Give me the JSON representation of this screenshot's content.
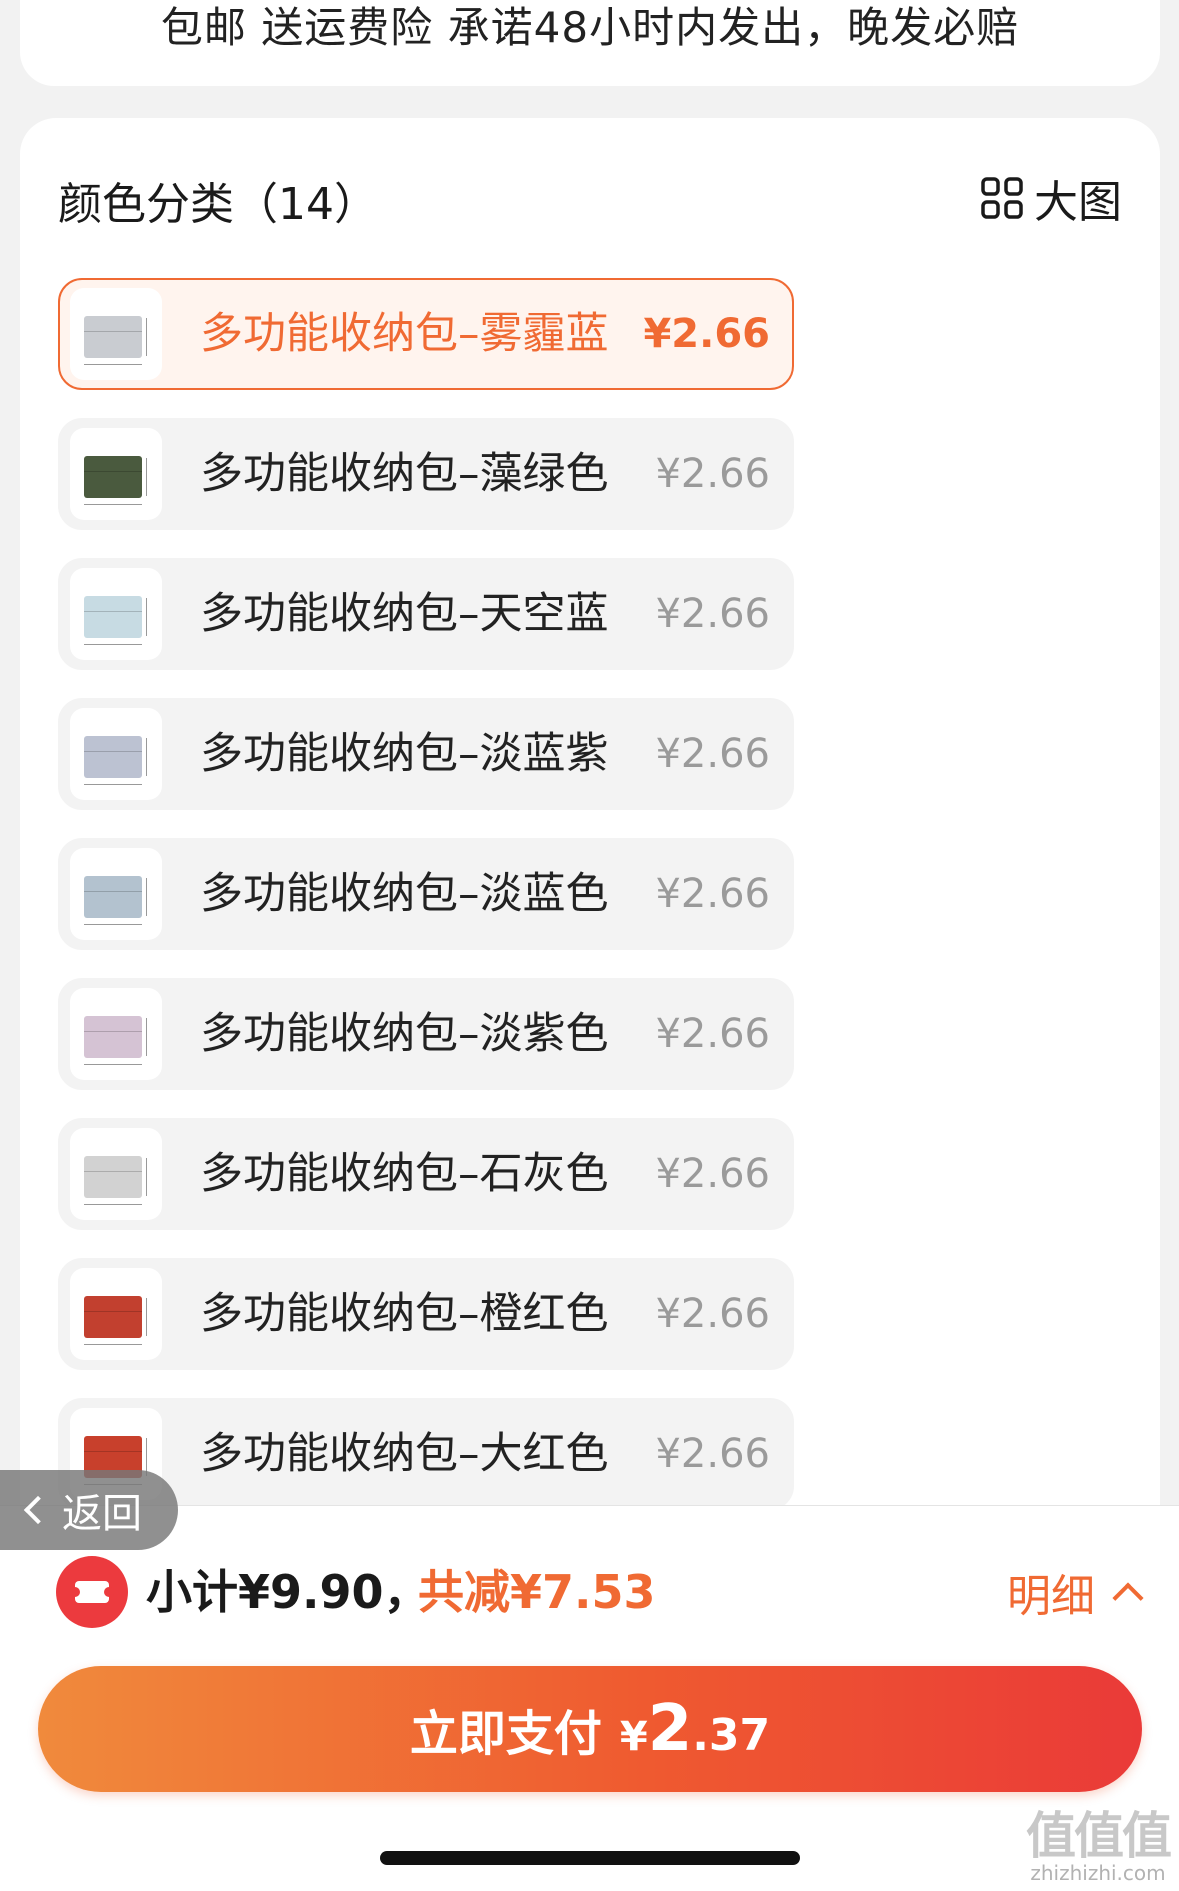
{
  "promo": {
    "text": "包邮 送运费险 承诺48小时内发出，晚发必赔"
  },
  "sku_panel": {
    "title": "颜色分类（14）",
    "bigview_label": "大图",
    "items": [
      {
        "name": "多功能收纳包–雾霾蓝",
        "price": "¥2.66",
        "selected": true,
        "swatch": "#c9ccd1"
      },
      {
        "name": "多功能收纳包–藻绿色",
        "price": "¥2.66",
        "selected": false,
        "swatch": "#4a5a3e"
      },
      {
        "name": "多功能收纳包–天空蓝",
        "price": "¥2.66",
        "selected": false,
        "swatch": "#c7dbe3"
      },
      {
        "name": "多功能收纳包–淡蓝紫",
        "price": "¥2.66",
        "selected": false,
        "swatch": "#bcc2d2"
      },
      {
        "name": "多功能收纳包–淡蓝色",
        "price": "¥2.66",
        "selected": false,
        "swatch": "#b3c2cf"
      },
      {
        "name": "多功能收纳包–淡紫色",
        "price": "¥2.66",
        "selected": false,
        "swatch": "#d5c3d4"
      },
      {
        "name": "多功能收纳包–石灰色",
        "price": "¥2.66",
        "selected": false,
        "swatch": "#d2d2d2"
      },
      {
        "name": "多功能收纳包–橙红色",
        "price": "¥2.66",
        "selected": false,
        "swatch": "#c2402f"
      },
      {
        "name": "多功能收纳包–大红色",
        "price": "¥2.66",
        "selected": false,
        "swatch": "#c8402c"
      }
    ]
  },
  "back_button": {
    "label": "返回"
  },
  "footer": {
    "subtotal": "小计¥9.90，",
    "discount": "共减¥7.53",
    "detail_label": "明细",
    "pay_label": "立即支付",
    "pay_currency": "¥",
    "pay_integer": "2",
    "pay_decimal": ".37"
  },
  "watermark": {
    "main": "值值值",
    "sub": "zhizhizhi.com"
  },
  "colors": {
    "accent": "#f06a33",
    "coupon_red": "#ec3a3e",
    "background": "#f2f2f2"
  }
}
